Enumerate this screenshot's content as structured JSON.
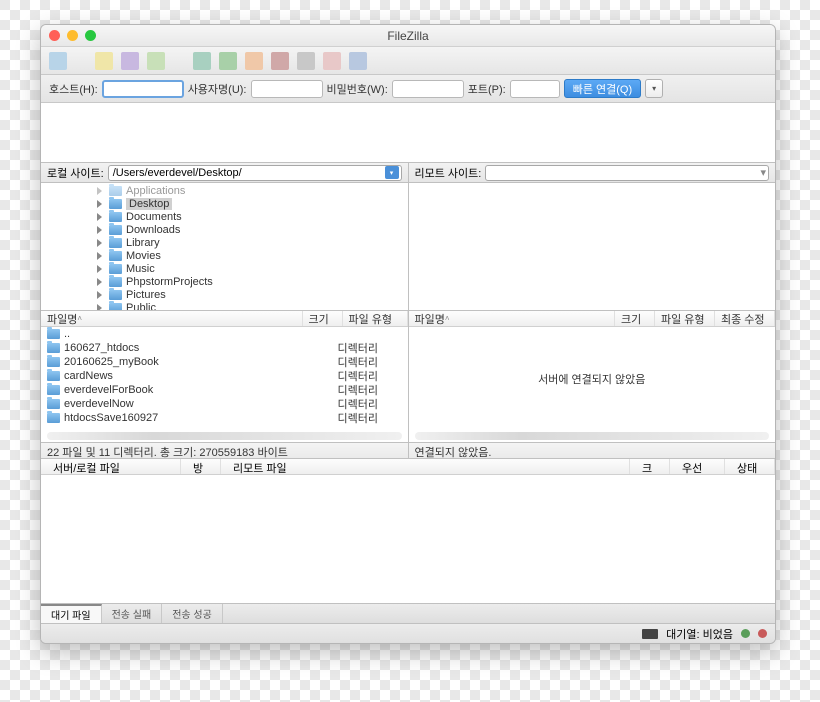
{
  "title": "FileZilla",
  "quickbar": {
    "host_label": "호스트(H):",
    "user_label": "사용자명(U):",
    "pass_label": "비밀번호(W):",
    "port_label": "포트(P):",
    "connect": "빠른 연결(Q)"
  },
  "local_site_label": "로컬 사이트:",
  "remote_site_label": "리모트 사이트:",
  "local_path": "/Users/everdevel/Desktop/",
  "tree": [
    "Applications",
    "Desktop",
    "Documents",
    "Downloads",
    "Library",
    "Movies",
    "Music",
    "PhpstormProjects",
    "Pictures",
    "Public"
  ],
  "file_headers": {
    "name": "파일명",
    "size": "크기",
    "type": "파일 유형",
    "modified": "최종 수정"
  },
  "files": [
    {
      "name": "..",
      "type": ""
    },
    {
      "name": "160627_htdocs",
      "type": "디렉터리"
    },
    {
      "name": "20160625_myBook",
      "type": "디렉터리"
    },
    {
      "name": "cardNews",
      "type": "디렉터리"
    },
    {
      "name": "everdevelForBook",
      "type": "디렉터리"
    },
    {
      "name": "everdevelNow",
      "type": "디렉터리"
    },
    {
      "name": "htdocsSave160927",
      "type": "디렉터리"
    }
  ],
  "no_connection": "서버에 연결되지 않았음",
  "local_status": "22 파일 및 11 디렉터리. 총 크기: 270559183 바이트",
  "remote_status": "연결되지 않았음.",
  "queue_headers": {
    "server": "서버/로컬 파일",
    "direction": "방향",
    "remote": "리모트 파일",
    "size": "크기",
    "priority": "우선 순위",
    "status": "상태"
  },
  "tabs": {
    "queue": "대기 파일",
    "failed": "전송 실패",
    "success": "전송 성공"
  },
  "footer": "대기열: 비었음"
}
